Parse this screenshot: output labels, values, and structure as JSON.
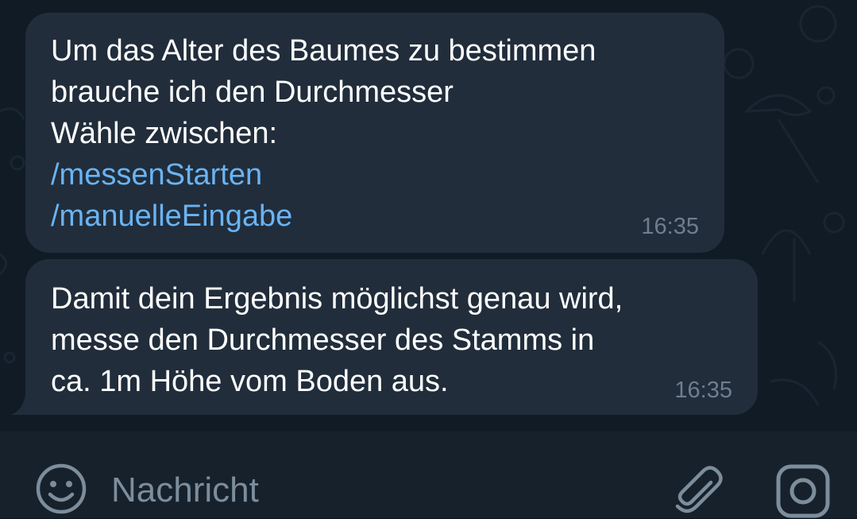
{
  "messages": [
    {
      "lines": [
        "Um das Alter des Baumes zu bestimmen",
        "brauche ich den Durchmesser",
        "Wähle zwischen:"
      ],
      "commands": [
        "/messenStarten",
        "/manuelleEingabe"
      ],
      "time": "16:35"
    },
    {
      "lines": [
        "Damit dein Ergebnis möglichst genau wird,",
        "messe den Durchmesser des Stamms in",
        "ca. 1m Höhe vom Boden aus."
      ],
      "time": "16:35"
    }
  ],
  "input": {
    "placeholder": "Nachricht",
    "value": ""
  },
  "icons": {
    "emoji": "smiley-icon",
    "attach": "paperclip-icon",
    "camera": "instagram-camera-icon"
  },
  "colors": {
    "chat_background": "#101b26",
    "bubble": "#212d3b",
    "link": "#6ab3f3",
    "timestamp": "#6d7f8f",
    "input_bar": "#17212b"
  }
}
